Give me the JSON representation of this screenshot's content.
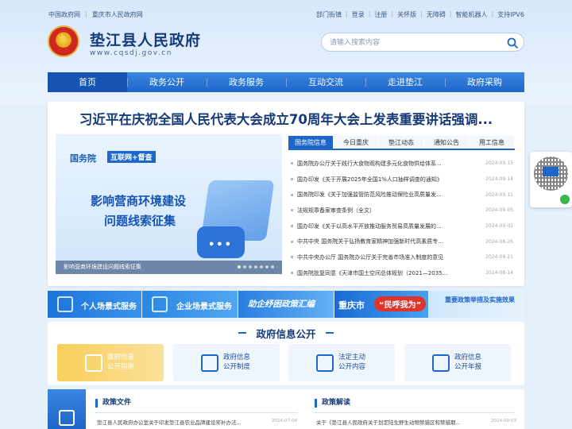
{
  "top_links_left": [
    "中国政府网",
    "重庆市人民政府网"
  ],
  "top_links_right": [
    "部门街镇",
    "登录",
    "注册",
    "关怀版",
    "无障碍",
    "智能机器人",
    "支持IPV6"
  ],
  "site": {
    "title": "垫江县人民政府",
    "domain": "www.cqsdj.gov.cn"
  },
  "search": {
    "placeholder": "请输入搜索内容"
  },
  "nav": [
    "首页",
    "政务公开",
    "政务服务",
    "互动交流",
    "走进垫江",
    "政府采购"
  ],
  "headline": "习近平在庆祝全国人民代表大会成立70周年大会上发表重要讲话强调...",
  "banner": {
    "org": "国务院",
    "tag": "互联网+督查",
    "line1": "影响营商环境建设",
    "line2": "问题线索征集",
    "caption": "影响营商环境建设问题线索征集"
  },
  "news_tabs": [
    "国务院信息",
    "今日重庆",
    "垫江动态",
    "通知公告",
    "用工信息"
  ],
  "news": [
    {
      "title": "国务院办公厅关于践行大食物观构建多元化食物供给体系...",
      "date": "2024-09-15"
    },
    {
      "title": "国办印发《关于开展2025年全国1%人口抽样调查的通知》",
      "date": "2024-09-14"
    },
    {
      "title": "国务院印发《关于加强监管防范风险推动保险业高质量发...",
      "date": "2024-09-11"
    },
    {
      "title": "法规规章备案审查条例（全文）",
      "date": "2024-09-05"
    },
    {
      "title": "国办印发《关于以高水平开放推动服务贸易高质量发展的...",
      "date": "2024-09-02"
    },
    {
      "title": "中共中央 国务院关于弘扬教育家精神加强新时代高素质专...",
      "date": "2024-08-26"
    },
    {
      "title": "中共中央办公厅 国务院办公厅关于完善市场准入制度的意见",
      "date": "2024-08-21"
    },
    {
      "title": "国务院批复同意《天津市国土空间总体规划（2021—2035...",
      "date": "2024-08-14"
    }
  ],
  "strips": {
    "personal": "个人场景式服务",
    "enterprise": "企业场景式服务",
    "assist": "助企纾困政策汇编",
    "cq": "重庆市",
    "cq_pill": "“民呼我为”",
    "policy": "重要政策举措及实施效果"
  },
  "info": {
    "title": "政府信息公开",
    "cards": [
      {
        "l1": "政府信息",
        "l2": "公开指南"
      },
      {
        "l1": "政府信息",
        "l2": "公开制度"
      },
      {
        "l1": "法定主动",
        "l2": "公开内容"
      },
      {
        "l1": "政府信息",
        "l2": "公开年报"
      }
    ]
  },
  "bottom": {
    "left_title": "政策文件",
    "left_item": "垫江县人民政府办公室关于印发垫江县农业品牌建设奖补办法...",
    "left_date": "2024-07-04",
    "right_title": "政策解读",
    "right_item": "关于《垫江县人民政府关于划定陆生野生动物禁猎区和禁猎期...",
    "right_date": "2024-09-03"
  },
  "colors": {
    "primary": "#1e66c8",
    "dark_title": "#163b7a",
    "accent_red": "#e0342a"
  }
}
